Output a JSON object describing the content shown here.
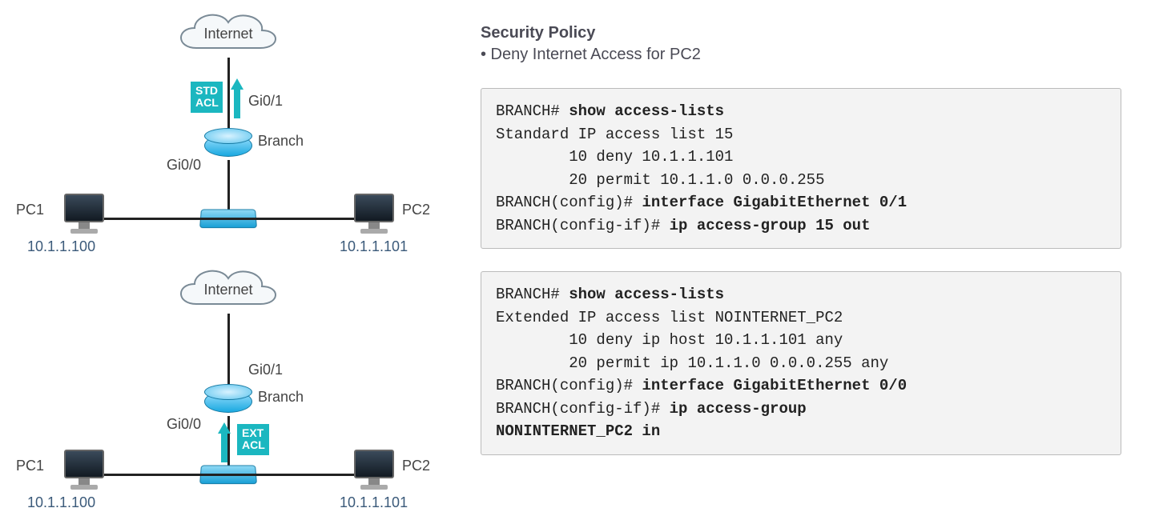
{
  "policy": {
    "heading": "Security Policy",
    "bullet": "• Deny Internet Access for PC2"
  },
  "diagram1": {
    "internet": "Internet",
    "acl_tag_l1": "STD",
    "acl_tag_l2": "ACL",
    "gi01": "Gi0/1",
    "branch": "Branch",
    "gi00": "Gi0/0",
    "pc1": "PC1",
    "pc1_ip": "10.1.1.100",
    "pc2": "PC2",
    "pc2_ip": "10.1.1.101"
  },
  "diagram2": {
    "internet": "Internet",
    "acl_tag_l1": "EXT",
    "acl_tag_l2": "ACL",
    "gi01": "Gi0/1",
    "branch": "Branch",
    "gi00": "Gi0/0",
    "pc1": "PC1",
    "pc1_ip": "10.1.1.100",
    "pc2": "PC2",
    "pc2_ip": "10.1.1.101"
  },
  "term1": {
    "l1a": "BRANCH# ",
    "l1b": "show access-lists",
    "l2": "Standard IP access list 15",
    "l3": "        10 deny 10.1.1.101",
    "l4": "        20 permit 10.1.1.0 0.0.0.255",
    "l5a": "BRANCH(config)# ",
    "l5b": "interface GigabitEthernet 0/1",
    "l6a": "BRANCH(config-if)# ",
    "l6b": "ip access-group 15 out"
  },
  "term2": {
    "l1a": "BRANCH# ",
    "l1b": "show access-lists",
    "l2": "Extended IP access list NOINTERNET_PC2",
    "l3": "        10 deny ip host 10.1.1.101 any",
    "l4": "        20 permit ip 10.1.1.0 0.0.0.255 any",
    "l5a": "BRANCH(config)# ",
    "l5b": "interface GigabitEthernet 0/0",
    "l6a": "BRANCH(config-if)# ",
    "l6b": "ip access-group",
    "l7b": "NONINTERNET_PC2 in"
  }
}
